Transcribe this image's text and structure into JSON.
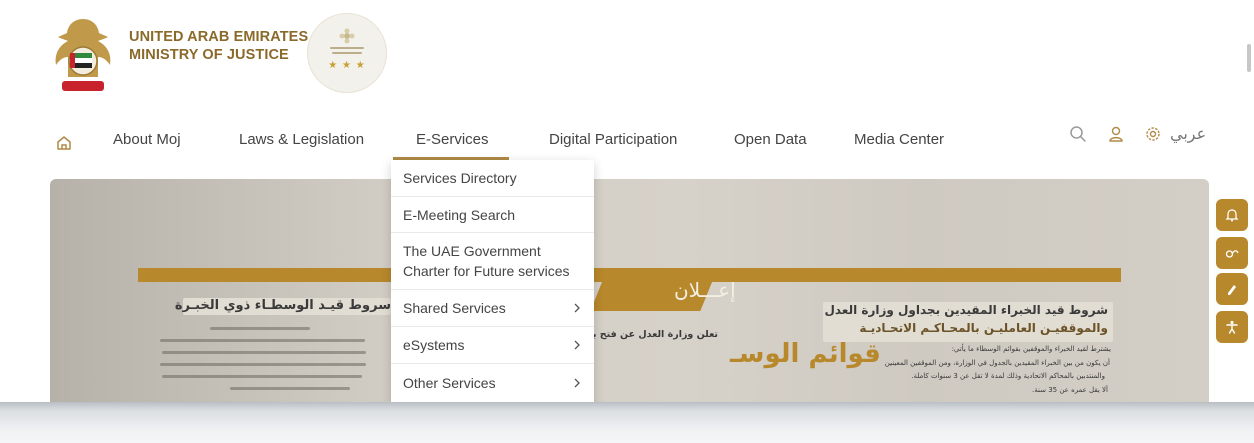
{
  "header": {
    "country_name": "UNITED ARAB EMIRATES",
    "ministry_name": "MINISTRY OF JUSTICE"
  },
  "nav": {
    "items": [
      {
        "label": "About Moj"
      },
      {
        "label": "Laws & Legislation"
      },
      {
        "label": "E-Services"
      },
      {
        "label": "Digital Participation"
      },
      {
        "label": "Open Data"
      },
      {
        "label": "Media Center"
      }
    ],
    "language_toggle": "عربي",
    "active_item": "E-Services",
    "icons": [
      "home-icon",
      "search-icon",
      "user-icon",
      "settings-icon"
    ]
  },
  "dropdown": {
    "items": [
      {
        "label": "Services Directory",
        "has_submenu": false
      },
      {
        "label": "E-Meeting Search",
        "has_submenu": false
      },
      {
        "label": "The UAE Government Charter for Future services",
        "has_submenu": false
      },
      {
        "label": "Shared Services",
        "has_submenu": true
      },
      {
        "label": "eSystems",
        "has_submenu": true
      },
      {
        "label": "Other Services",
        "has_submenu": true
      }
    ]
  },
  "hero": {
    "banner": "إعـــلان",
    "center_heading": "تعلن وزارة العدل عن فتح باب",
    "center_big": "قوائم الوسـ",
    "left_heading": "سروط قيـد الوسطـاء ذوي الخبـرة",
    "right_heading_1": "شروط قيد الخبراء المقيدين بجداول وزارة العدل",
    "right_heading_2": "والموقفيـن العامليـن بالمحـاكـم الاتحـاديـة",
    "right_line_1": "يشترط لقيد الخبراء والموقفين بقوائم الوسطاء ما يأتي:",
    "right_line_2": "أن يكون من بين الخبراء المقيدين بالجدول في الوزارة، ومن الموقفين المعينين",
    "right_line_3": "والمنتدبين بالمحاكم الاتحادية وذلك لمدة لا تقل عن 3 سنوات كاملة.",
    "right_line_4": "ألا يقل عمره عن 35 سنة."
  },
  "colors": {
    "accent": "#b8882c",
    "brand_text": "#8a6a2b"
  },
  "side_buttons": [
    "bell-icon",
    "feedback-icon",
    "edit-icon",
    "accessibility-icon"
  ]
}
